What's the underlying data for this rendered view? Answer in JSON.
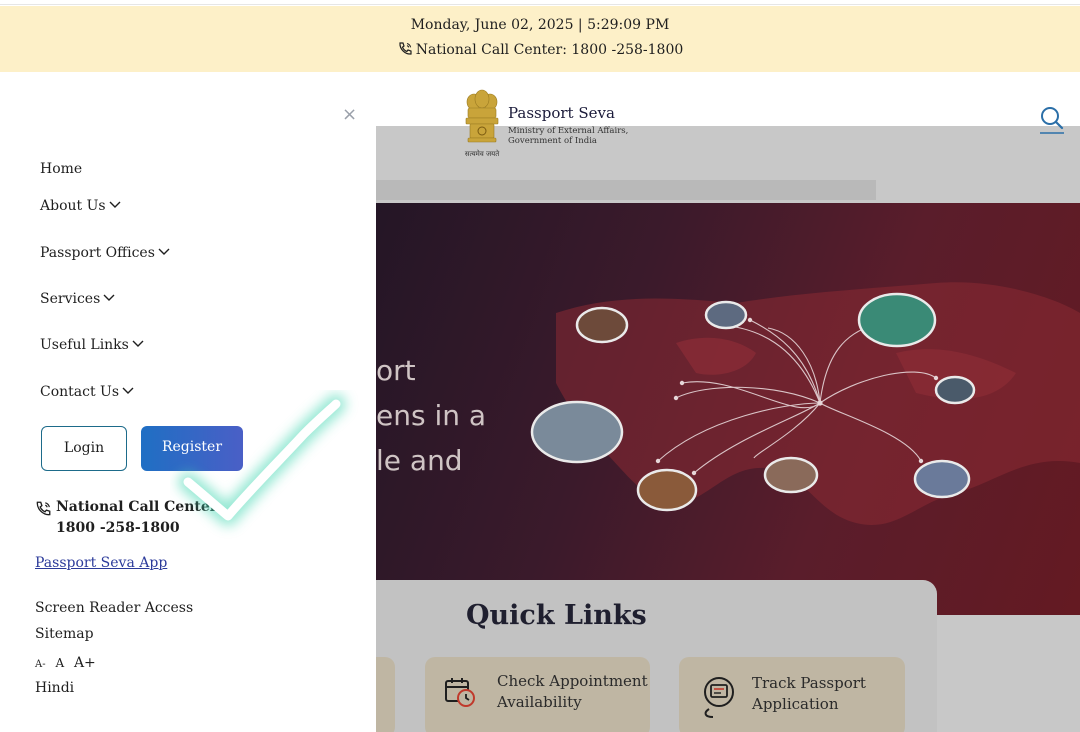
{
  "topbar": {
    "datetime": "Monday, June 02, 2025 | 5:29:09 PM",
    "call_center": "National Call Center: 1800 -258-1800"
  },
  "brand": {
    "title": "Passport Seva",
    "subtitle_line1": "Ministry of External Affairs,",
    "subtitle_line2": "Government of India",
    "emblem_caption": "सत्यमेव जयते"
  },
  "drawer": {
    "close_symbol": "×",
    "nav": [
      {
        "label": "Home",
        "has_dropdown": false
      },
      {
        "label": "About Us",
        "has_dropdown": true
      },
      {
        "label": "Passport Offices",
        "has_dropdown": true
      },
      {
        "label": "Services",
        "has_dropdown": true
      },
      {
        "label": "Useful Links",
        "has_dropdown": true
      },
      {
        "label": "Contact Us",
        "has_dropdown": true
      }
    ],
    "login_label": "Login",
    "register_label": "Register",
    "call_label": "National Call Center",
    "call_number": "1800 -258-1800",
    "app_link": "Passport Seva App",
    "screen_reader": "Screen Reader Access",
    "sitemap": "Sitemap",
    "font_small": "A-",
    "font_normal": "A",
    "font_large": "A+",
    "language": "Hindi"
  },
  "background_page": {
    "hero_line1": "ort",
    "hero_line2": "ens in a",
    "hero_line3": "le and",
    "quick_links_title": "Quick Links",
    "cards": [
      {
        "label_line1": "Check Appointment",
        "label_line2": "Availability",
        "icon": "calendar-clock-icon"
      },
      {
        "label_line1": "Track Passport",
        "label_line2": "Application",
        "icon": "track-location-icon"
      }
    ]
  },
  "colors": {
    "topbar_bg": "#fdf0c8",
    "register_gradient_start": "#1f6fc4",
    "register_gradient_end": "#4a5fc6",
    "login_border": "#1d6b8a",
    "hero_dark": "#3b1a2b",
    "hero_red": "#641a22",
    "card_bg": "#bfb6a3",
    "checkmark": "#ffffff",
    "checkmark_glow": "#3fd6b0"
  }
}
